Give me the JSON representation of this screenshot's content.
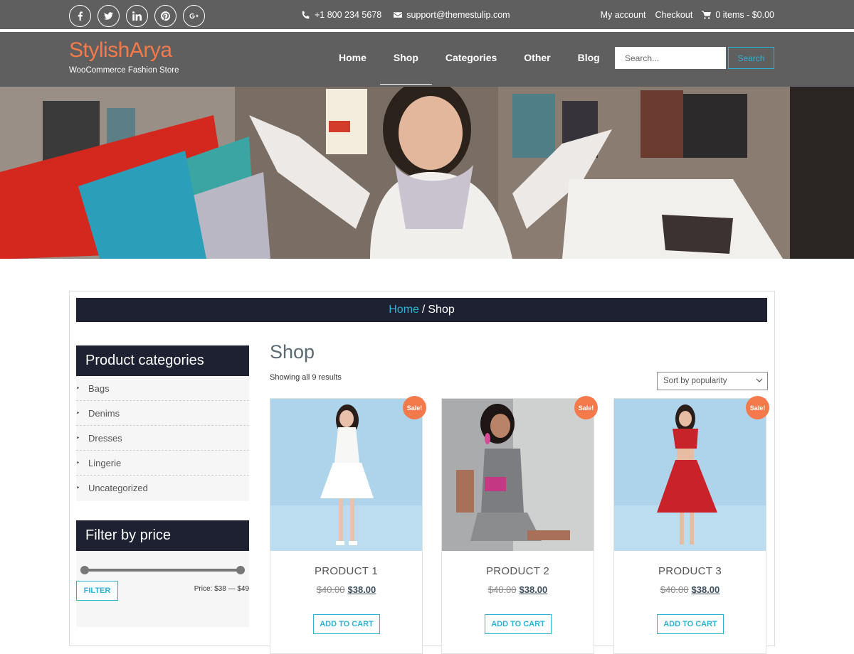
{
  "topbar": {
    "social": [
      {
        "icon": "facebook-icon",
        "glyph": "f"
      },
      {
        "icon": "twitter-icon",
        "glyph": "t"
      },
      {
        "icon": "linkedin-icon",
        "glyph": "in"
      },
      {
        "icon": "pinterest-icon",
        "glyph": "p"
      },
      {
        "icon": "google-plus-icon",
        "glyph": "g+"
      }
    ],
    "phone": "+1 800 234 5678",
    "email": "support@themestulip.com",
    "my_account": "My account",
    "checkout": "Checkout",
    "cart": "0 items - $0.00"
  },
  "header": {
    "logo_title": "StylishArya",
    "logo_subtitle": "WooCommerce Fashion Store",
    "nav": [
      "Home",
      "Shop",
      "Categories",
      "Other",
      "Blog"
    ],
    "active_nav": "Shop",
    "search_placeholder": "Search...",
    "search_button": "Search"
  },
  "breadcrumb": {
    "home": "Home",
    "separator": "/",
    "current": "Shop"
  },
  "sidebar": {
    "categories_title": "Product categories",
    "categories": [
      "Bags",
      "Denims",
      "Dresses",
      "Lingerie",
      "Uncategorized"
    ],
    "filter_title": "Filter by price",
    "filter_button": "FILTER",
    "price_range": "Price: $38 — $49",
    "slider_min_fraction": 0,
    "slider_max_fraction": 1
  },
  "main": {
    "title": "Shop",
    "result_count": "Showing all 9 results",
    "sort_selected": "Sort by popularity"
  },
  "products": [
    {
      "name": "PRODUCT 1",
      "old_price": "$40.00",
      "price": "$38.00",
      "badge": "Sale!",
      "button": "ADD TO CART"
    },
    {
      "name": "PRODUCT 2",
      "old_price": "$40.00",
      "price": "$38.00",
      "badge": "Sale!",
      "button": "ADD TO CART"
    },
    {
      "name": "PRODUCT 3",
      "old_price": "$40.00",
      "price": "$38.00",
      "badge": "Sale!",
      "button": "ADD TO CART"
    }
  ],
  "colors": {
    "header_bg": "#5f5f5f",
    "logo": "#f47a4b",
    "accent": "#2ab3d4",
    "dark_bar": "#1e2131",
    "sale": "#f47a4b"
  }
}
